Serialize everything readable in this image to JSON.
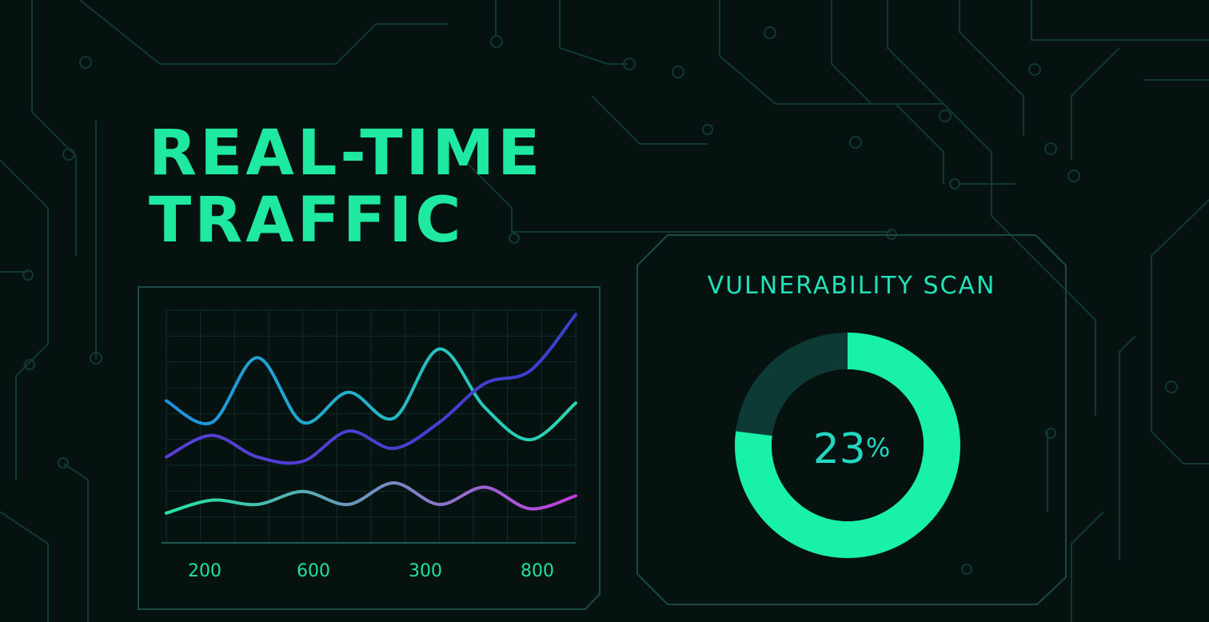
{
  "title": {
    "line1": "REAL-TIME",
    "line2": "TRAFFIC"
  },
  "colors": {
    "background": "#06120f",
    "circuit": "#123833",
    "accent": "#1fe8a0",
    "donut_fill": "#19f0a8",
    "donut_track": "#0e3a36",
    "grid": "#0f2e2a"
  },
  "chart_data": {
    "type": "line",
    "categories": [
      "200",
      "600",
      "300",
      "800"
    ],
    "grid": true,
    "series": [
      {
        "color_start": "#1f8fe0",
        "color_end": "#2ad9b0",
        "values": [
          0.58,
          0.48,
          0.78,
          0.48,
          0.62,
          0.5,
          0.82,
          0.55,
          0.4,
          0.57
        ]
      },
      {
        "color_start": "#5a3fd6",
        "color_end": "#3b3fcf",
        "values": [
          0.32,
          0.42,
          0.32,
          0.3,
          0.44,
          0.36,
          0.48,
          0.66,
          0.72,
          0.98
        ]
      },
      {
        "color_start": "#22e5a0",
        "color_end": "#c03ce0",
        "values": [
          0.06,
          0.12,
          0.1,
          0.16,
          0.1,
          0.2,
          0.1,
          0.18,
          0.08,
          0.14
        ]
      }
    ]
  },
  "scan": {
    "title": "VULNERABILITY SCAN",
    "value": 23,
    "value_text": "23",
    "unit": "%"
  }
}
